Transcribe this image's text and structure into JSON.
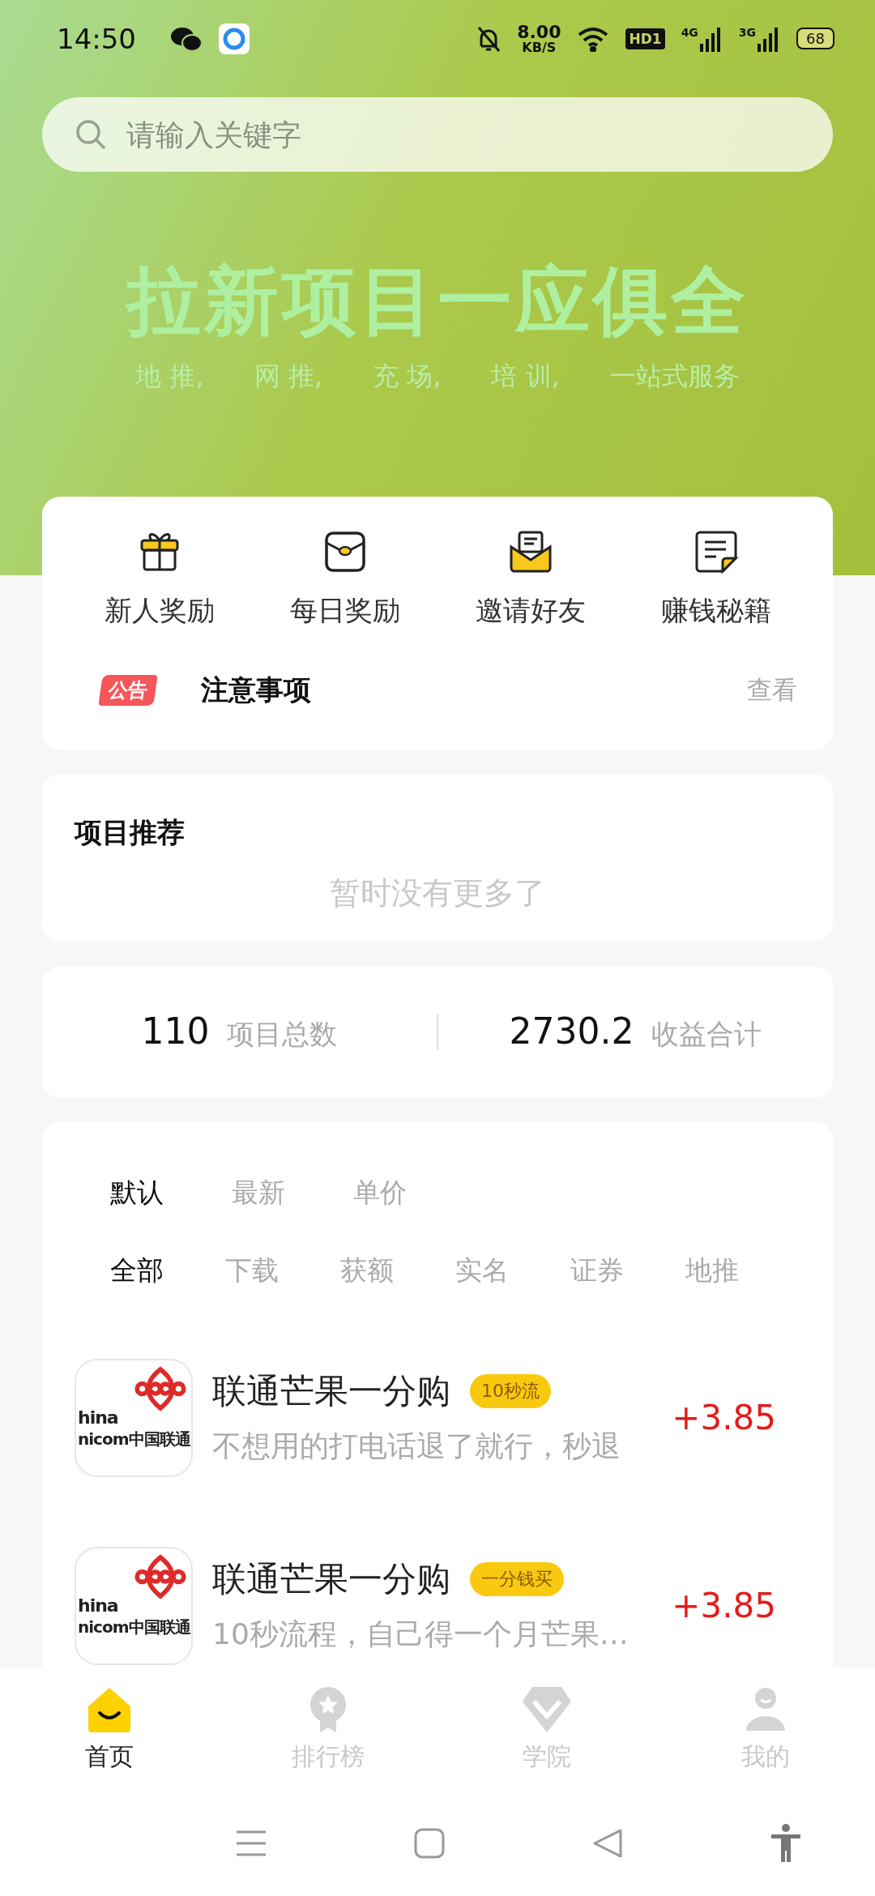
{
  "status_bar": {
    "time": "14:50",
    "speed": "8.00",
    "speed_unit": "KB/S",
    "hd": "HD1",
    "net_1": "4G",
    "net_2": "3G",
    "battery": "68"
  },
  "search": {
    "placeholder": "请输入关键字"
  },
  "banner": {
    "title": "拉新项目一应俱全",
    "subtitle": [
      "地 推,",
      "网 推,",
      "充 场,",
      "培 训,",
      "一站式服务"
    ]
  },
  "shortcuts": [
    {
      "kind": "gift",
      "label": "新人奖励"
    },
    {
      "kind": "packet",
      "label": "每日奖励"
    },
    {
      "kind": "mail",
      "label": "邀请好友"
    },
    {
      "kind": "note",
      "label": "赚钱秘籍"
    }
  ],
  "notice": {
    "badge": "公告",
    "text": "注意事项",
    "action": "查看"
  },
  "recommend": {
    "title": "项目推荐",
    "empty": "暂时没有更多了"
  },
  "stats": [
    {
      "value": "110",
      "label": "项目总数"
    },
    {
      "value": "2730.2",
      "label": "收益合计"
    }
  ],
  "sort_tabs": [
    {
      "label": "默认",
      "selected": true
    },
    {
      "label": "最新",
      "selected": false
    },
    {
      "label": "单价",
      "selected": false
    }
  ],
  "filter_tabs": [
    {
      "label": "全部",
      "selected": true
    },
    {
      "label": "下载",
      "selected": false
    },
    {
      "label": "获额",
      "selected": false
    },
    {
      "label": "实名",
      "selected": false
    },
    {
      "label": "证券",
      "selected": false
    },
    {
      "label": "地推",
      "selected": false
    }
  ],
  "projects": [
    {
      "logo_text": [
        "hina",
        "nicom中国联通"
      ],
      "title": "联通芒果一分购",
      "tag": "10秒流",
      "desc": "不想用的打电话退了就行，秒退",
      "price": "+3.85"
    },
    {
      "logo_text": [
        "hina",
        "nicom中国联通"
      ],
      "title": "联通芒果一分购",
      "tag": "一分钱买",
      "desc": "10秒流程，自己得一个月芒果…",
      "price": "+3.85"
    }
  ],
  "bottom_nav": [
    {
      "kind": "home",
      "label": "首页",
      "selected": true
    },
    {
      "kind": "rank",
      "label": "排行榜",
      "selected": false
    },
    {
      "kind": "academy",
      "label": "学院",
      "selected": false
    },
    {
      "kind": "me",
      "label": "我的",
      "selected": false
    }
  ]
}
